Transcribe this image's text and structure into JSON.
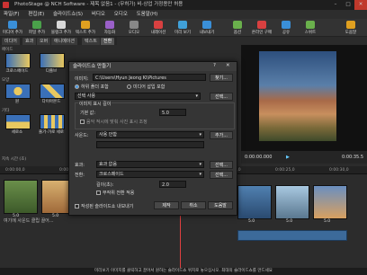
{
  "window": {
    "title": "PhotoStage @ NCH Software - 제목 없음1 - (무허가) 비-상업 가정용만 허용",
    "min": "–",
    "max": "□",
    "close": "✕"
  },
  "menu": [
    "파일(F)",
    "편집(E)",
    "슬라이드쇼(S)",
    "비디오",
    "오디오",
    "도움말(H)"
  ],
  "toolbar": [
    {
      "label": "미디어 추가",
      "color": "#3a8fd8"
    },
    {
      "label": "파일 추가",
      "color": "#4aa14a"
    },
    {
      "label": "블랭크 추가",
      "color": "#d8d8d8"
    },
    {
      "label": "텍스트 추가",
      "color": "#e0a020"
    },
    {
      "label": "자동화",
      "color": "#9a60c8"
    },
    {
      "label": "오디오",
      "color": "#888888"
    },
    {
      "label": "내레이션",
      "color": "#d84040"
    },
    {
      "label": "미리 보기",
      "color": "#40a0d8"
    },
    {
      "label": "내보내기",
      "color": "#3a8fd8"
    },
    {
      "label": "옵션",
      "color": "#6ab04c"
    },
    {
      "label": "온라인 구매",
      "color": "#d84040"
    },
    {
      "label": "공유",
      "color": "#3a8fd8"
    },
    {
      "label": "스위트",
      "color": "#6ab04c"
    },
    {
      "label": "도움말",
      "color": "#e0a020"
    }
  ],
  "tabs": [
    "미디어",
    "효과",
    "오버",
    "애니메이션",
    "텍스트",
    "전환"
  ],
  "left_panel": {
    "categories": [
      "페이드",
      "모양",
      "기타"
    ],
    "items": [
      "크로스페이드",
      "디졸브",
      "원",
      "다이아몬드",
      "세로소",
      "줄기-가로 세로",
      "지속 시간 (초)"
    ]
  },
  "dialog": {
    "title": "슬라이드쇼 만들기",
    "help": "?",
    "close": "✕",
    "folder_label": "이미지:",
    "folder_value": "C:\\Users\\Hyun Jeong Ki\\Pictures",
    "browse": "찾기...",
    "radio_folder": "하위 폴더 포함",
    "radio_media": "미디어 삽입 포함",
    "order_value": "선택 사용",
    "select_btn": "선택...",
    "duration_label": "이미지 표시 길이",
    "duration_sub": "기본 값:",
    "duration_value": "5.0",
    "duration_hint": "음악 적시에 맞춰 사진 표시 조정",
    "sound_label": "사운드:",
    "sound_value": "사용 안함",
    "add_btn": "추가...",
    "effect_label": "효과:",
    "effect_value": "효과 없음",
    "transition_label": "전환:",
    "transition_value": "크로스페이드",
    "tlen_label": "길이(초):",
    "tlen_value": "2.0",
    "random_label": "무작위 전환 적용",
    "preview_check": "작성된 슬라이드쇼 내보내기",
    "create": "제작",
    "cancel": "취소",
    "help_btn": "도움말"
  },
  "preview": {
    "time": "0:00:00.000",
    "end": "0:00:35.5"
  },
  "ruler": [
    "0:00:00,0",
    "0:00:05,0",
    "0:00:10,0",
    "0:00:15,0",
    "0:00:20,0",
    "0:00:25,0",
    "0:00:30,0"
  ],
  "timeline": {
    "clip_durations": [
      "5.0",
      "5.0",
      "5.0",
      "5.0",
      "5.0",
      "5.0",
      "5.0"
    ],
    "audio_hint": "여기에 사운드 클립 끌어..."
  },
  "status": "미리보기 이미지를 클릭하고 끌어서 원하는 슬라이드쇼 위치로 놓으십시오. 최대의 슬라이드쇼를 만드세요",
  "colors": {
    "accent": "#3a8fd8",
    "bg": "#2b2b2b"
  }
}
